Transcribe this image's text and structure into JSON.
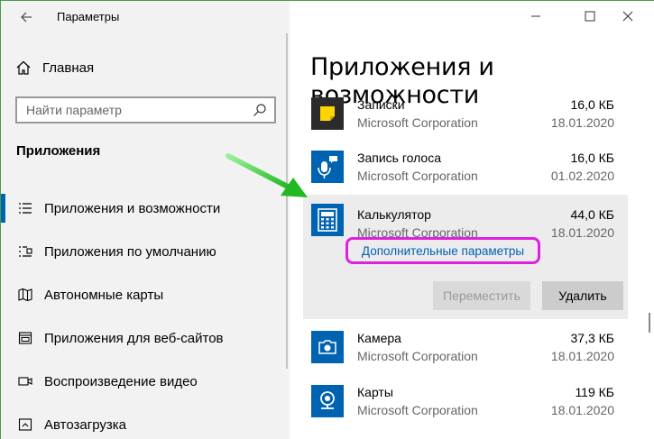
{
  "window": {
    "title": "Параметры"
  },
  "sidebar": {
    "home_label": "Главная",
    "search_placeholder": "Найти параметр",
    "section_label": "Приложения",
    "items": [
      {
        "label": "Приложения и возможности",
        "icon": "apps-features-icon",
        "active": true
      },
      {
        "label": "Приложения по умолчанию",
        "icon": "default-apps-icon",
        "active": false
      },
      {
        "label": "Автономные карты",
        "icon": "offline-maps-icon",
        "active": false
      },
      {
        "label": "Приложения для веб-сайтов",
        "icon": "apps-for-websites-icon",
        "active": false
      },
      {
        "label": "Воспроизведение видео",
        "icon": "video-playback-icon",
        "active": false
      },
      {
        "label": "Автозагрузка",
        "icon": "startup-icon",
        "active": false
      }
    ]
  },
  "main": {
    "title": "Приложения и возможности",
    "apps": [
      {
        "name": "Записки",
        "publisher": "Microsoft Corporation",
        "size": "16,0 КБ",
        "date": "18.01.2020",
        "icon": "sticky-notes-icon",
        "color": "#2b2b2b"
      },
      {
        "name": "Запись голоса",
        "publisher": "Microsoft Corporation",
        "size": "16,0 КБ",
        "date": "01.02.2020",
        "icon": "voice-recorder-icon",
        "color": "#0063b1"
      },
      {
        "name": "Калькулятор",
        "publisher": "Microsoft Corporation",
        "size": "44,0 КБ",
        "date": "18.01.2020",
        "icon": "calculator-icon",
        "color": "#0063b1",
        "expanded": true
      },
      {
        "name": "Камера",
        "publisher": "Microsoft Corporation",
        "size": "37,3 КБ",
        "date": "18.01.2020",
        "icon": "camera-icon",
        "color": "#0063b1"
      },
      {
        "name": "Карты",
        "publisher": "Microsoft Corporation",
        "size": "119 КБ",
        "date": "18.01.2020",
        "icon": "maps-icon",
        "color": "#0063b1"
      }
    ],
    "advanced_options_link": "Дополнительные параметры",
    "move_button": "Переместить",
    "uninstall_button": "Удалить"
  },
  "colors": {
    "accent": "#0063b1",
    "highlight": "#e020e0",
    "arrow": "#3ecf3e"
  }
}
